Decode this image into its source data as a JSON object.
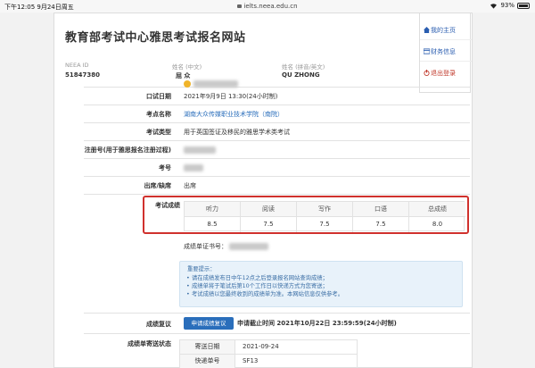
{
  "statusbar": {
    "time": "下午12:05  9月24日周五",
    "url": "ielts.neea.edu.cn",
    "battery": "93%"
  },
  "site": {
    "title": "教育部考试中心雅思考试报名网站"
  },
  "user": {
    "id_label": "NEEA ID",
    "id_value": "51847380",
    "name_cn_label": "姓名 (中文)",
    "name_cn_value": "屈 众",
    "name_py_label": "姓名 (拼音/英文)",
    "name_py_value": "QU ZHONG"
  },
  "side_menu": {
    "home": "我的主页",
    "finance": "财务信息",
    "logout": "退出登录"
  },
  "rows": {
    "oral_date_label": "口试日期",
    "oral_date_value": "2021年9月9日 13:30(24小时制)",
    "venue_label": "考点名称",
    "venue_value": "湖南大众传媒职业技术学院（南院）",
    "exam_type_label": "考试类型",
    "exam_type_value": "用于英国签证及移民的雅思学术类考试",
    "reg_no_label": "注册号(用于雅思报名注册过程)",
    "exam_no_label": "考号",
    "attendance_label": "出席/缺席",
    "attendance_value": "出席",
    "scores_label": "考试成绩"
  },
  "scores": {
    "headers": [
      "听力",
      "阅读",
      "写作",
      "口语",
      "总成绩"
    ],
    "values": [
      "8.5",
      "7.5",
      "7.5",
      "7.5",
      "8.0"
    ]
  },
  "report_no_label": "成绩单证书号：",
  "notice": {
    "title": "重要提示：",
    "items": [
      "请在成绩发布日中午12点之后登录报名网站查询成绩；",
      "成绩单将于笔试后第10个工作日以快递方式为您寄送；",
      "考试成绩以您最终收到的成绩单为准。本网站信息仅供参考。"
    ]
  },
  "review": {
    "label": "成绩复议",
    "button": "申请成绩复议",
    "deadline": "申请截止时间 2021年10月22日 23:59:59(24小时制)"
  },
  "shipping": {
    "label": "成绩单寄送状态",
    "date_key": "寄送日期",
    "date_value": "2021-09-24",
    "tracking_key": "快递单号",
    "tracking_value": "SF13"
  }
}
